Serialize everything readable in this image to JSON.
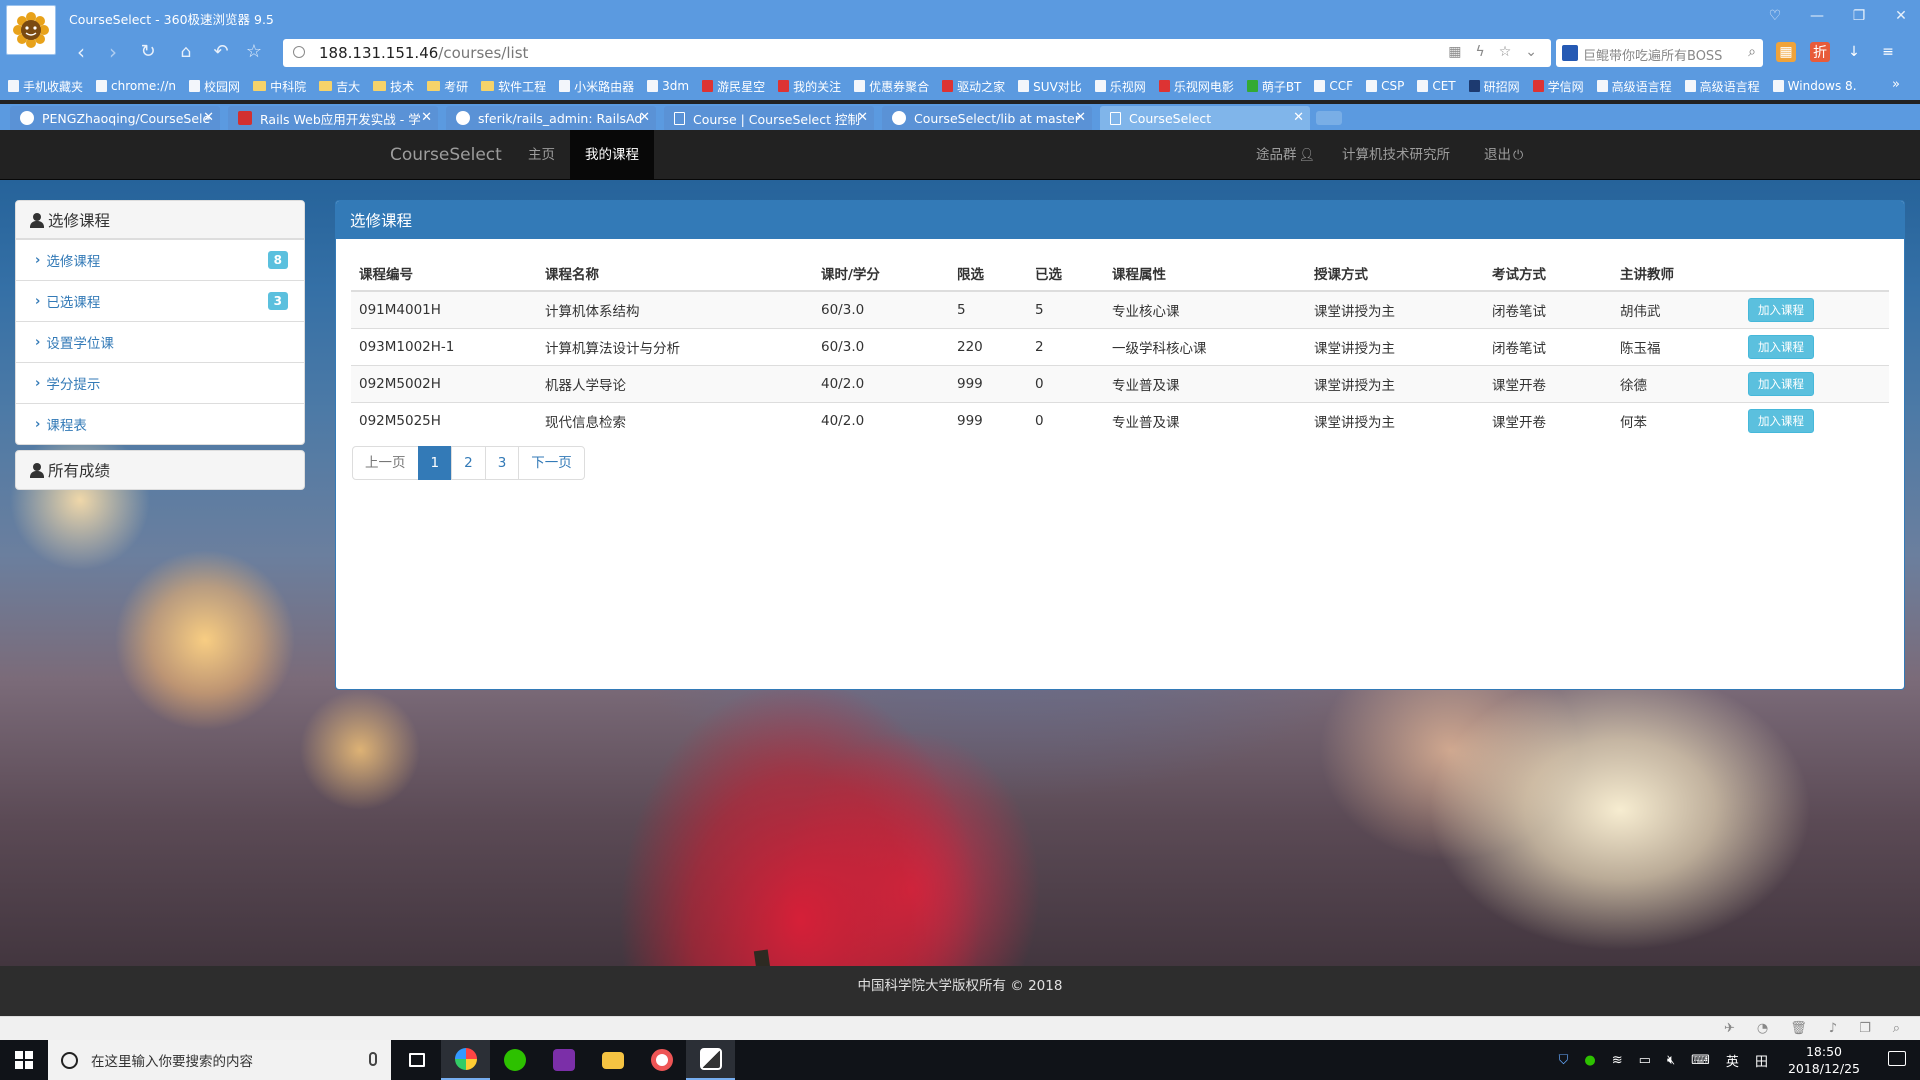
{
  "browser": {
    "window_title": "CourseSelect - 360极速浏览器 9.5",
    "url_host": "188.131.151.46",
    "url_path": "/courses/list",
    "search_placeholder": "巨鲲带你吃遍所有BOSS",
    "bookmarks": [
      "手机收藏夹",
      "chrome://n",
      "校园网",
      "中科院",
      "吉大",
      "技术",
      "考研",
      "软件工程",
      "小米路由器",
      "3dm",
      "游民星空",
      "我的关注",
      "优惠券聚合",
      "驱动之家",
      "SUV对比",
      "乐视网",
      "乐视网电影",
      "萌子BT",
      "CCF",
      "CSP",
      "CET",
      "研招网",
      "学信网",
      "高级语言程",
      "高级语言程",
      "Windows 8."
    ],
    "tabs": [
      "PENGZhaoqing/CourseSele",
      "Rails Web应用开发实战 - 学",
      "sferik/rails_admin: RailsAd",
      "Course | CourseSelect 控制",
      "CourseSelect/lib at master",
      "CourseSelect"
    ]
  },
  "site": {
    "brand": "CourseSelect",
    "nav": {
      "home": "主页",
      "my_courses": "我的课程"
    },
    "user": "途品群",
    "department": "计算机技术研究所",
    "logout": "退出"
  },
  "sidebar": {
    "section_title": "选修课程",
    "items": [
      {
        "label": "选修课程",
        "badge": "8"
      },
      {
        "label": "已选课程",
        "badge": "3"
      },
      {
        "label": "设置学位课",
        "badge": null
      },
      {
        "label": "学分提示",
        "badge": null
      },
      {
        "label": "课程表",
        "badge": null
      }
    ],
    "grades_title": "所有成绩"
  },
  "main": {
    "title": "选修课程",
    "columns": [
      "课程编号",
      "课程名称",
      "课时/学分",
      "限选",
      "已选",
      "课程属性",
      "授课方式",
      "考试方式",
      "主讲教师"
    ],
    "rows": [
      {
        "code": "091M4001H",
        "name": "计算机体系结构",
        "hours": "60/3.0",
        "limit": "5",
        "selected": "5",
        "attr": "专业核心课",
        "teach": "课堂讲授为主",
        "exam": "闭卷笔试",
        "teacher": "胡伟武"
      },
      {
        "code": "093M1002H-1",
        "name": "计算机算法设计与分析",
        "hours": "60/3.0",
        "limit": "220",
        "selected": "2",
        "attr": "一级学科核心课",
        "teach": "课堂讲授为主",
        "exam": "闭卷笔试",
        "teacher": "陈玉福"
      },
      {
        "code": "092M5002H",
        "name": "机器人学导论",
        "hours": "40/2.0",
        "limit": "999",
        "selected": "0",
        "attr": "专业普及课",
        "teach": "课堂讲授为主",
        "exam": "课堂开卷",
        "teacher": "徐德"
      },
      {
        "code": "092M5025H",
        "name": "现代信息检索",
        "hours": "40/2.0",
        "limit": "999",
        "selected": "0",
        "attr": "专业普及课",
        "teach": "课堂讲授为主",
        "exam": "课堂开卷",
        "teacher": "何苯"
      }
    ],
    "add_label": "加入课程",
    "pagination": {
      "prev": "上一页",
      "pages": [
        "1",
        "2",
        "3"
      ],
      "current": "1",
      "next": "下一页"
    }
  },
  "footer": "中国科学院大学版权所有 © 2018",
  "taskbar": {
    "search_placeholder": "在这里输入你要搜索的内容",
    "ime": "英",
    "time": "18:50",
    "date": "2018/12/25"
  },
  "colors": {
    "primary": "#337ab7",
    "info": "#5bc0de",
    "navbar": "#222222",
    "browser": "#5b9ae0"
  }
}
